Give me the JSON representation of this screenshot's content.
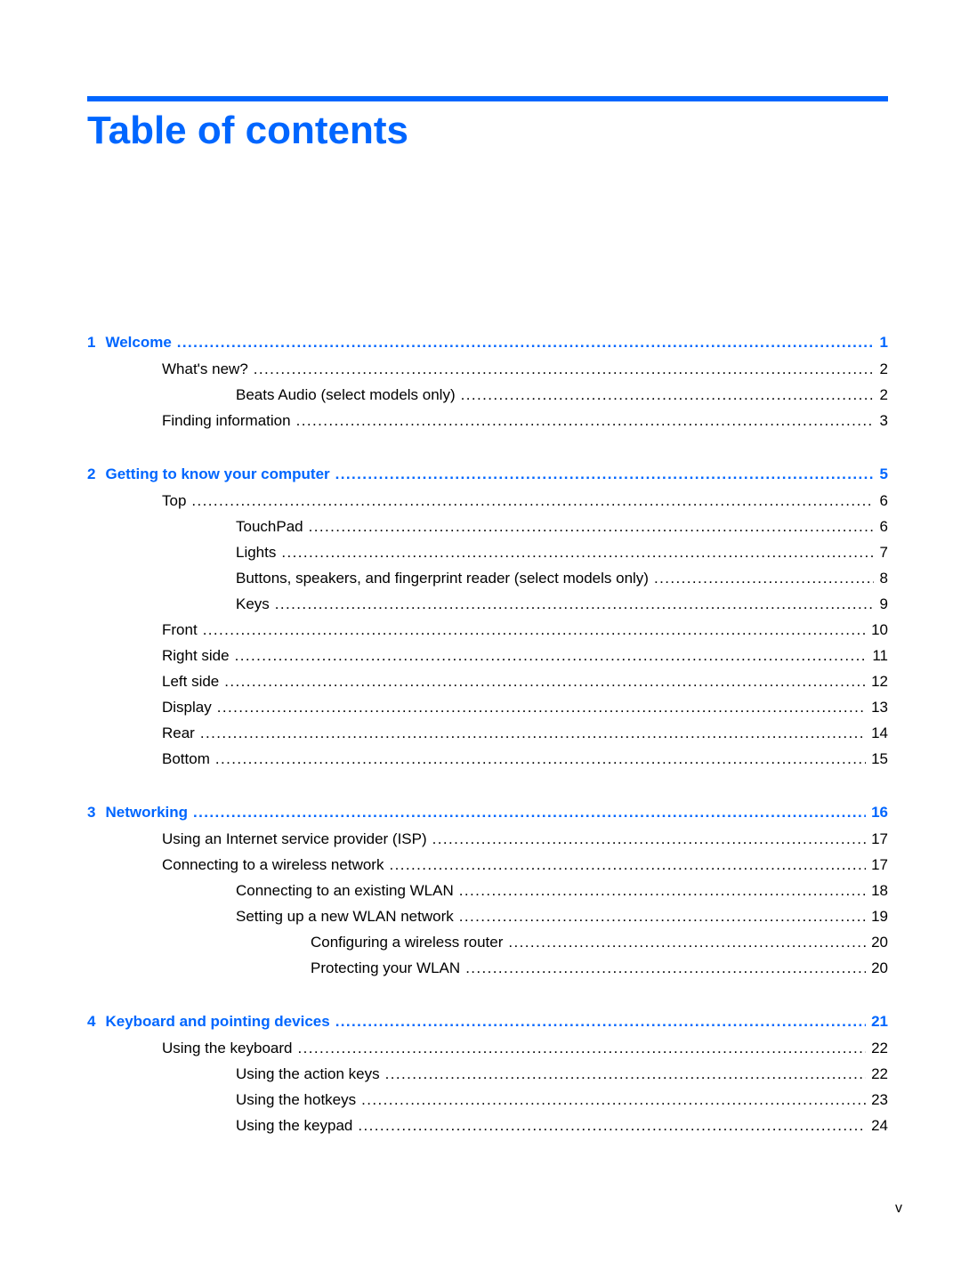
{
  "header": {
    "title": "Table of contents"
  },
  "toc": {
    "chapters": [
      {
        "number": "1",
        "title": "Welcome",
        "page": "1",
        "entries": [
          {
            "level": 1,
            "title": "What's new?",
            "page": "2"
          },
          {
            "level": 2,
            "title": "Beats Audio (select models only)",
            "page": "2"
          },
          {
            "level": 1,
            "title": "Finding information",
            "page": "3"
          }
        ]
      },
      {
        "number": "2",
        "title": "Getting to know your computer",
        "page": "5",
        "entries": [
          {
            "level": 1,
            "title": "Top",
            "page": "6"
          },
          {
            "level": 2,
            "title": "TouchPad",
            "page": "6"
          },
          {
            "level": 2,
            "title": "Lights",
            "page": "7"
          },
          {
            "level": 2,
            "title": "Buttons, speakers, and fingerprint reader (select models only)",
            "page": "8"
          },
          {
            "level": 2,
            "title": "Keys",
            "page": "9"
          },
          {
            "level": 1,
            "title": "Front",
            "page": "10"
          },
          {
            "level": 1,
            "title": "Right side",
            "page": "11"
          },
          {
            "level": 1,
            "title": "Left side",
            "page": "12"
          },
          {
            "level": 1,
            "title": "Display",
            "page": "13"
          },
          {
            "level": 1,
            "title": "Rear",
            "page": "14"
          },
          {
            "level": 1,
            "title": "Bottom",
            "page": "15"
          }
        ]
      },
      {
        "number": "3",
        "title": "Networking",
        "page": "16",
        "entries": [
          {
            "level": 1,
            "title": "Using an Internet service provider (ISP)",
            "page": "17"
          },
          {
            "level": 1,
            "title": "Connecting to a wireless network",
            "page": "17"
          },
          {
            "level": 2,
            "title": "Connecting to an existing WLAN",
            "page": "18"
          },
          {
            "level": 2,
            "title": "Setting up a new WLAN network",
            "page": "19"
          },
          {
            "level": 3,
            "title": "Configuring a wireless router",
            "page": "20"
          },
          {
            "level": 3,
            "title": "Protecting your WLAN",
            "page": "20"
          }
        ]
      },
      {
        "number": "4",
        "title": "Keyboard and pointing devices",
        "page": "21",
        "entries": [
          {
            "level": 1,
            "title": "Using the keyboard",
            "page": "22"
          },
          {
            "level": 2,
            "title": "Using the action keys",
            "page": "22"
          },
          {
            "level": 2,
            "title": "Using the hotkeys",
            "page": "23"
          },
          {
            "level": 2,
            "title": "Using the keypad",
            "page": "24"
          }
        ]
      }
    ]
  },
  "footer": {
    "page_number": "v"
  },
  "colors": {
    "accent": "#0066ff",
    "text": "#000000"
  }
}
